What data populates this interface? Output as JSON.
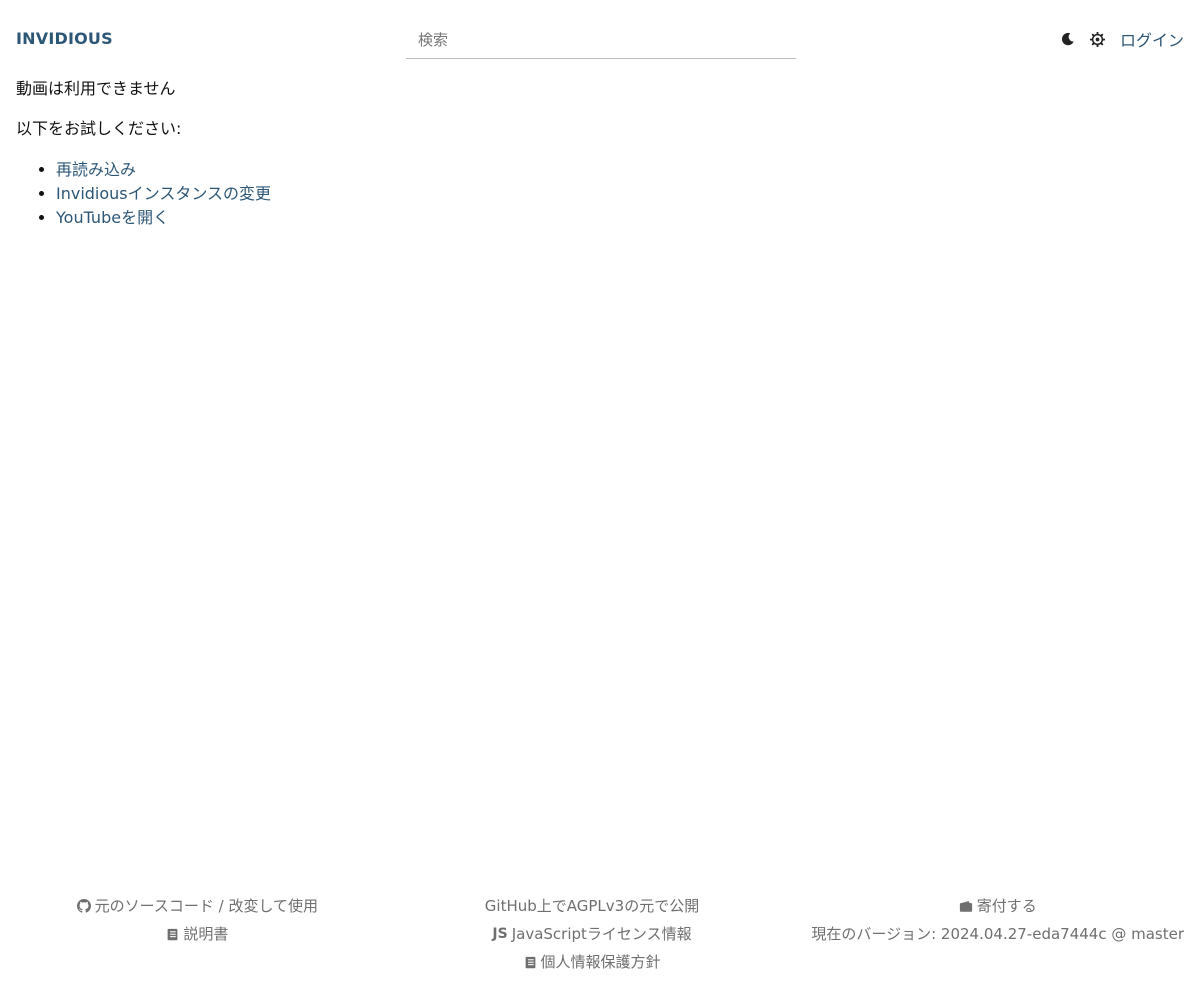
{
  "header": {
    "logo": "INVIDIOUS",
    "search_placeholder": "検索",
    "login": "ログイン",
    "icons": [
      "moon-icon",
      "gear-icon"
    ]
  },
  "main": {
    "title": "動画は利用できません",
    "subtitle": "以下をお試しください:",
    "suggestions": [
      "再読み込み",
      "Invidiousインスタンスの変更",
      "YouTubeを開く"
    ]
  },
  "footer": {
    "left": {
      "source": "元のソースコード / 改変して使用",
      "docs": "説明書"
    },
    "center": {
      "license": "GitHub上でAGPLv3の元で公開",
      "js_badge": "JS",
      "js_license": "JavaScriptライセンス情報",
      "privacy": "個人情報保護方針"
    },
    "right": {
      "donate": "寄付する",
      "version": "現在のバージョン: 2024.04.27-eda7444c @ master"
    }
  },
  "colors": {
    "link": "#2c5777",
    "footer_text": "#6f6f6f"
  }
}
